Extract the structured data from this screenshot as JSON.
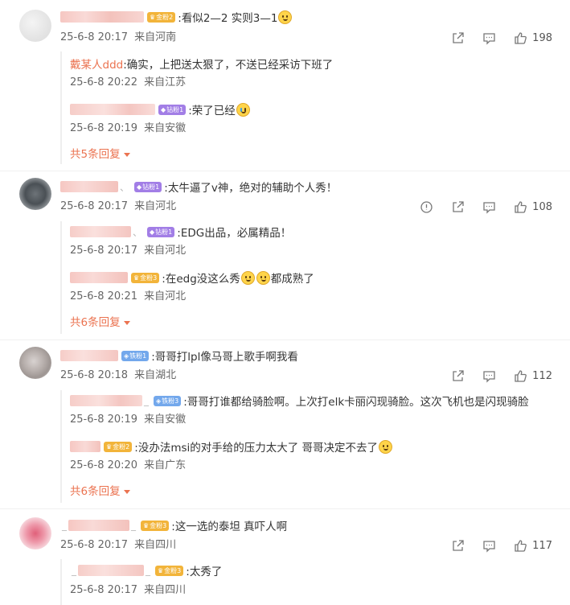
{
  "colors": {
    "accent": "#eb7350",
    "badge_gold": "#f2b43a",
    "badge_diamond": "#a27ee6",
    "badge_iron": "#73a8ec"
  },
  "comments": [
    {
      "badge": {
        "icon": "gold-fan-icon",
        "label": "金粉2"
      },
      "text": ":看似2—2 实则3—1",
      "emoji": "laugh-emoji",
      "meta": {
        "time": "25-6-8 20:17",
        "location": "来自河南"
      },
      "likes": "198",
      "replies": [
        {
          "username": "戴某人ddd",
          "text": ":确实，上把送太狠了，不送已经采访下班了",
          "time": "25-6-8 20:22",
          "location": "来自江苏"
        },
        {
          "badge": {
            "icon": "diamond-fan-icon",
            "label": "钻粉1"
          },
          "text": ":荣了已经",
          "emoji": "cry-emoji",
          "time": "25-6-8 20:19",
          "location": "来自安徽"
        }
      ],
      "more_label": "共5条回复"
    },
    {
      "badge": {
        "icon": "diamond-fan-icon",
        "label": "钻粉1"
      },
      "text": ":太牛逼了v神，绝对的辅助个人秀！",
      "meta": {
        "time": "25-6-8 20:17",
        "location": "来自河北"
      },
      "likes": "108",
      "replies": [
        {
          "badge": {
            "icon": "diamond-fan-icon",
            "label": "钻粉1"
          },
          "text": ":EDG出品，必属精品！",
          "time": "25-6-8 20:17",
          "location": "来自河北"
        },
        {
          "badge": {
            "icon": "gold-fan-icon",
            "label": "金粉3"
          },
          "text": ":在edg没这么秀",
          "text2": "都成熟了",
          "time": "25-6-8 20:21",
          "location": "来自河北"
        }
      ],
      "more_label": "共6条回复"
    },
    {
      "badge": {
        "icon": "iron-fan-icon",
        "label": "铁粉1"
      },
      "text": ":哥哥打lpl像马哥上歌手啊我看",
      "meta": {
        "time": "25-6-8 20:18",
        "location": "来自湖北"
      },
      "likes": "112",
      "replies": [
        {
          "badge": {
            "icon": "iron-fan-icon",
            "label": "铁粉3"
          },
          "text": ":哥哥打谁都给骑脸啊。上次打elk卡丽闪现骑脸。这次飞机也是闪现骑脸",
          "time": "25-6-8 20:19",
          "location": "来自安徽"
        },
        {
          "badge": {
            "icon": "gold-fan-icon",
            "label": "金粉2"
          },
          "text": ":没办法msi的对手给的压力太大了 哥哥决定不去了",
          "emoji": "laugh-emoji",
          "time": "25-6-8 20:20",
          "location": "来自广东"
        }
      ],
      "more_label": "共6条回复"
    },
    {
      "badge": {
        "icon": "gold-fan-icon",
        "label": "金粉3"
      },
      "text": ":这一选的泰坦  真吓人啊",
      "meta": {
        "time": "25-6-8 20:17",
        "location": "来自四川"
      },
      "likes": "117",
      "replies": [
        {
          "badge": {
            "icon": "gold-fan-icon",
            "label": "金粉3"
          },
          "text": ":太秀了",
          "time": "25-6-8 20:17",
          "location": "来自四川"
        }
      ]
    }
  ]
}
